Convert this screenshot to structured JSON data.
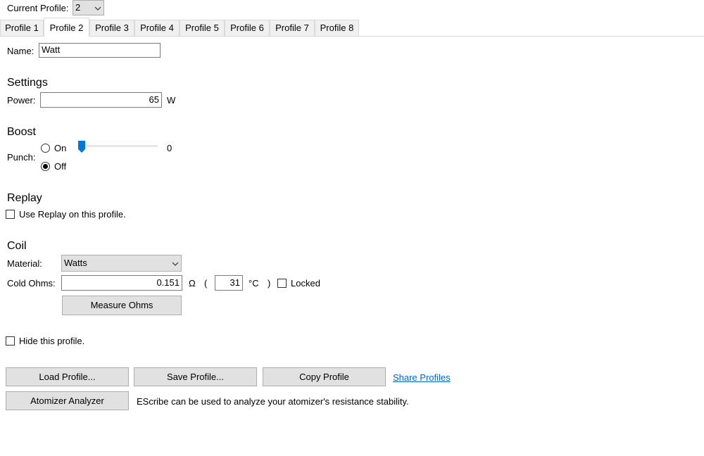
{
  "header": {
    "current_profile_label": "Current Profile:",
    "current_profile_value": "2"
  },
  "tabs": [
    {
      "label": "Profile 1"
    },
    {
      "label": "Profile 2"
    },
    {
      "label": "Profile 3"
    },
    {
      "label": "Profile 4"
    },
    {
      "label": "Profile 5"
    },
    {
      "label": "Profile 6"
    },
    {
      "label": "Profile 7"
    },
    {
      "label": "Profile 8"
    }
  ],
  "active_tab": "Profile 2",
  "name": {
    "label": "Name:",
    "value": "Watt"
  },
  "settings": {
    "title": "Settings",
    "power_label": "Power:",
    "power_value": "65",
    "power_unit": "W"
  },
  "boost": {
    "title": "Boost",
    "punch_label": "Punch:",
    "on_label": "On",
    "off_label": "Off",
    "selected": "Off",
    "slider_value": "0"
  },
  "replay": {
    "title": "Replay",
    "checkbox_label": "Use Replay on this profile.",
    "checked": false
  },
  "coil": {
    "title": "Coil",
    "material_label": "Material:",
    "material_value": "Watts",
    "cold_ohms_label": "Cold Ohms:",
    "cold_ohms_value": "0.151",
    "ohm_symbol": "Ω",
    "open_paren": "(",
    "temp_value": "31",
    "temp_unit": "°C",
    "close_paren": ")",
    "locked_label": "Locked",
    "locked_checked": false,
    "measure_button": "Measure Ohms"
  },
  "hide": {
    "label": "Hide this profile.",
    "checked": false
  },
  "actions": {
    "load": "Load Profile...",
    "save": "Save Profile...",
    "copy": "Copy Profile",
    "share": "Share Profiles",
    "analyzer": "Atomizer Analyzer",
    "analyzer_note": "EScribe can be used to analyze your atomizer's resistance stability."
  },
  "colors": {
    "accent": "#0078d7",
    "link": "#0066cc",
    "button_bg": "#e1e1e1"
  }
}
